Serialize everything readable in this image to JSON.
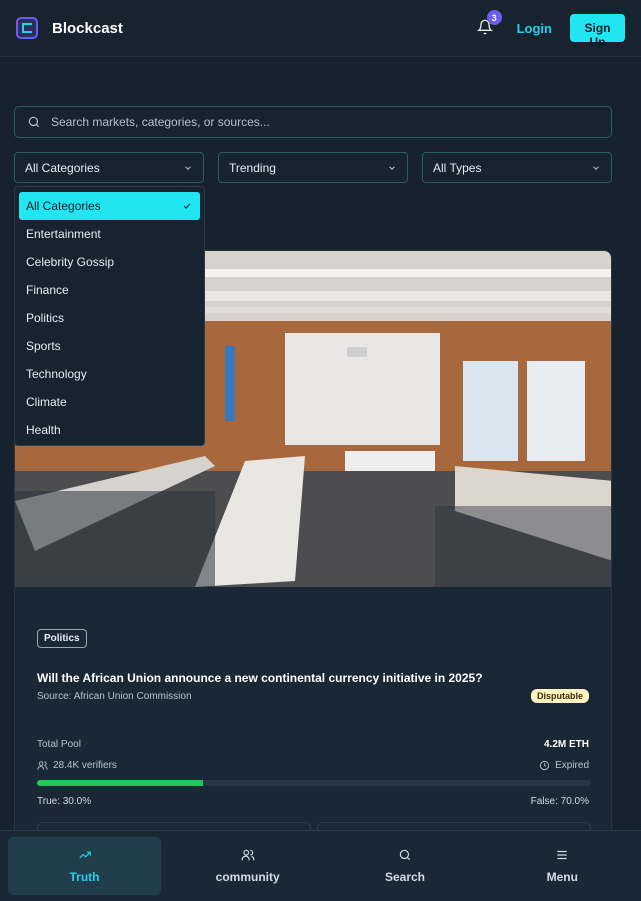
{
  "header": {
    "brand": "Blockcast",
    "notifications_count": "3",
    "login_label": "Login",
    "signup_label": "Sign Up"
  },
  "search": {
    "placeholder": "Search markets, categories, or sources..."
  },
  "filters": {
    "category": "All Categories",
    "sort": "Trending",
    "type": "All Types"
  },
  "category_dropdown": {
    "items": [
      "All Categories",
      "Entertainment",
      "Celebrity Gossip",
      "Finance",
      "Politics",
      "Sports",
      "Technology",
      "Climate",
      "Health"
    ],
    "selected": "All Categories"
  },
  "market_card": {
    "category_tag": "Politics",
    "question": "Will the African Union announce a new continental currency initiative in 2025?",
    "source": "Source: African Union Commission",
    "status": "Disputable",
    "total_pool_label": "Total Pool",
    "total_pool_value": "4.2M ETH",
    "verifiers": "28.4K verifiers",
    "expiry_status": "Expired",
    "true_percent": 30.0,
    "true_label": "True: 30.0%",
    "false_label": "False: 70.0%"
  },
  "bottom_nav": {
    "items": [
      {
        "label": "Truth",
        "icon": "trending-up-icon",
        "active": true
      },
      {
        "label": "community",
        "icon": "users-icon",
        "active": false
      },
      {
        "label": "Search",
        "icon": "search-icon",
        "active": false
      },
      {
        "label": "Menu",
        "icon": "menu-icon",
        "active": false
      }
    ]
  },
  "colors": {
    "accent": "#22e5f2",
    "brand_purple": "#6d5cf0",
    "progress_true": "#22c55e",
    "background": "#16222e"
  }
}
